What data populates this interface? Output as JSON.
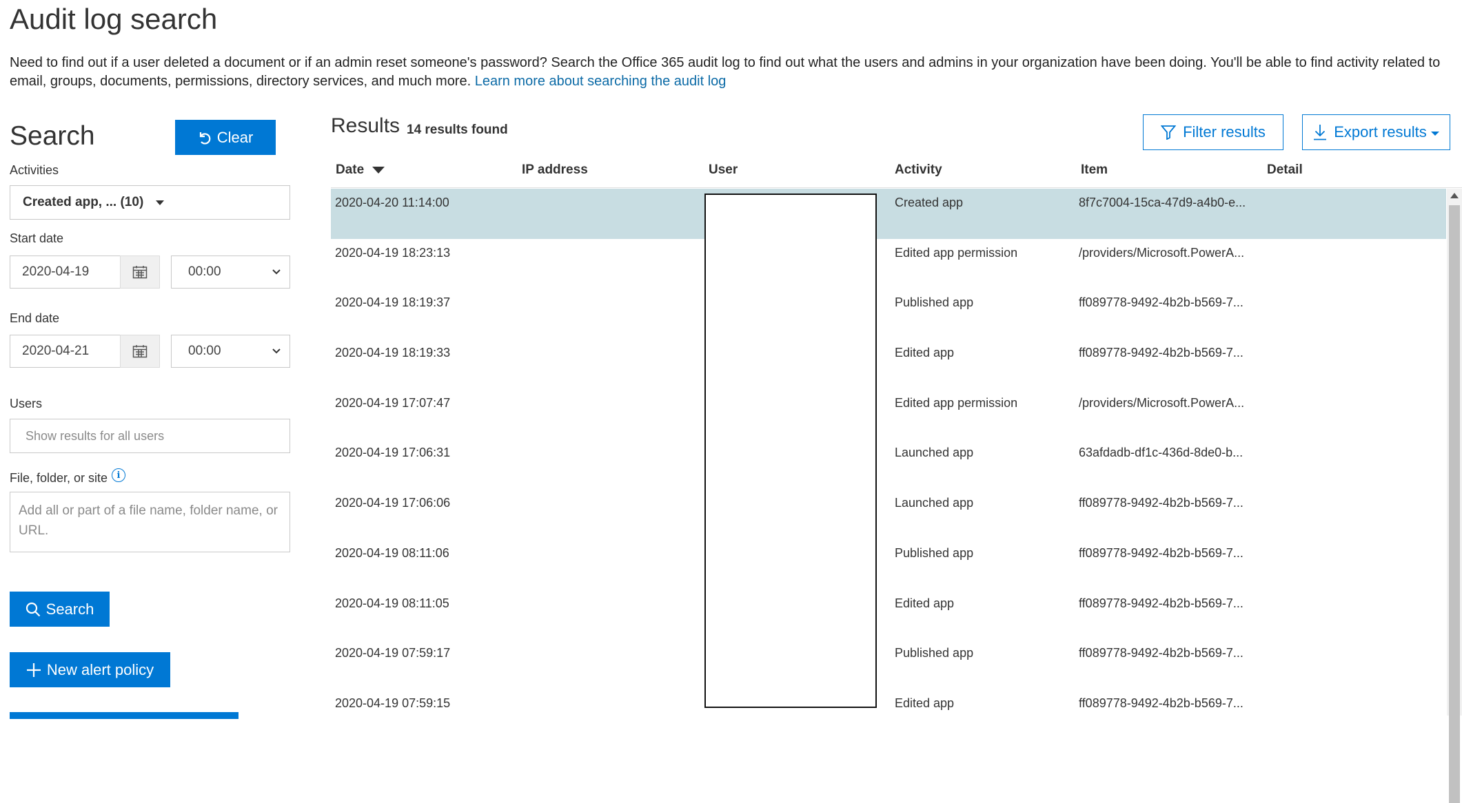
{
  "page": {
    "title": "Audit log search",
    "intro_text": "Need to find out if a user deleted a document or if an admin reset someone's password? Search the Office 365 audit log to find out what the users and admins in your organization have been doing. You'll be able to find activity related to email, groups, documents, permissions, directory services, and much more.",
    "intro_link": "Learn more about searching the audit log"
  },
  "search_panel": {
    "title": "Search",
    "clear_label": "Clear",
    "activities_label": "Activities",
    "activities_value": "Created app, ... (10)",
    "start_date_label": "Start date",
    "start_date": "2020-04-19",
    "start_time": "00:00",
    "end_date_label": "End date",
    "end_date": "2020-04-21",
    "end_time": "00:00",
    "users_label": "Users",
    "users_placeholder": "Show results for all users",
    "file_label": "File, folder, or site",
    "file_placeholder": "Add all or part of a file name, folder name, or URL.",
    "search_label": "Search",
    "new_alert_label": "New alert policy"
  },
  "results": {
    "title": "Results",
    "count": "14 results found",
    "filter_label": "Filter results",
    "export_label": "Export results",
    "columns": [
      "Date",
      "IP address",
      "User",
      "Activity",
      "Item",
      "Detail"
    ],
    "rows": [
      {
        "date": "2020-04-20 11:14:00",
        "ip": "",
        "user": "",
        "activity": "Created app",
        "item": "8f7c7004-15ca-47d9-a4b0-e...",
        "detail": ""
      },
      {
        "date": "2020-04-19 18:23:13",
        "ip": "",
        "user": "..",
        "activity": "Edited app permission",
        "item": "/providers/Microsoft.PowerA...",
        "detail": ""
      },
      {
        "date": "2020-04-19 18:19:37",
        "ip": "",
        "user": "..",
        "activity": "Published app",
        "item": "ff089778-9492-4b2b-b569-7...",
        "detail": ""
      },
      {
        "date": "2020-04-19 18:19:33",
        "ip": "",
        "user": "..",
        "activity": "Edited app",
        "item": "ff089778-9492-4b2b-b569-7...",
        "detail": ""
      },
      {
        "date": "2020-04-19 17:07:47",
        "ip": "",
        "user": "..",
        "activity": "Edited app permission",
        "item": "/providers/Microsoft.PowerA...",
        "detail": ""
      },
      {
        "date": "2020-04-19 17:06:31",
        "ip": "",
        "user": "..",
        "activity": "Launched app",
        "item": "63afdadb-df1c-436d-8de0-b...",
        "detail": ""
      },
      {
        "date": "2020-04-19 17:06:06",
        "ip": "",
        "user": "..",
        "activity": "Launched app",
        "item": "ff089778-9492-4b2b-b569-7...",
        "detail": ""
      },
      {
        "date": "2020-04-19 08:11:06",
        "ip": "",
        "user": "..",
        "activity": "Published app",
        "item": "ff089778-9492-4b2b-b569-7...",
        "detail": ""
      },
      {
        "date": "2020-04-19 08:11:05",
        "ip": "",
        "user": "..",
        "activity": "Edited app",
        "item": "ff089778-9492-4b2b-b569-7...",
        "detail": ""
      },
      {
        "date": "2020-04-19 07:59:17",
        "ip": "",
        "user": "..",
        "activity": "Published app",
        "item": "ff089778-9492-4b2b-b569-7...",
        "detail": ""
      },
      {
        "date": "2020-04-19 07:59:15",
        "ip": "",
        "user": "",
        "activity": "Edited app",
        "item": "ff089778-9492-4b2b-b569-7...",
        "detail": ""
      }
    ],
    "selected_row": 0
  },
  "icons": {
    "clear": "undo-icon",
    "calendar": "calendar-icon",
    "info": "info-icon",
    "search": "search-icon",
    "add": "plus-icon",
    "filter": "filter-icon",
    "export": "download-icon",
    "sort": "sort-descending-icon"
  },
  "colors": {
    "accent": "#0078d4",
    "link": "#0b6aa6",
    "selected_row": "#c8dde2"
  }
}
